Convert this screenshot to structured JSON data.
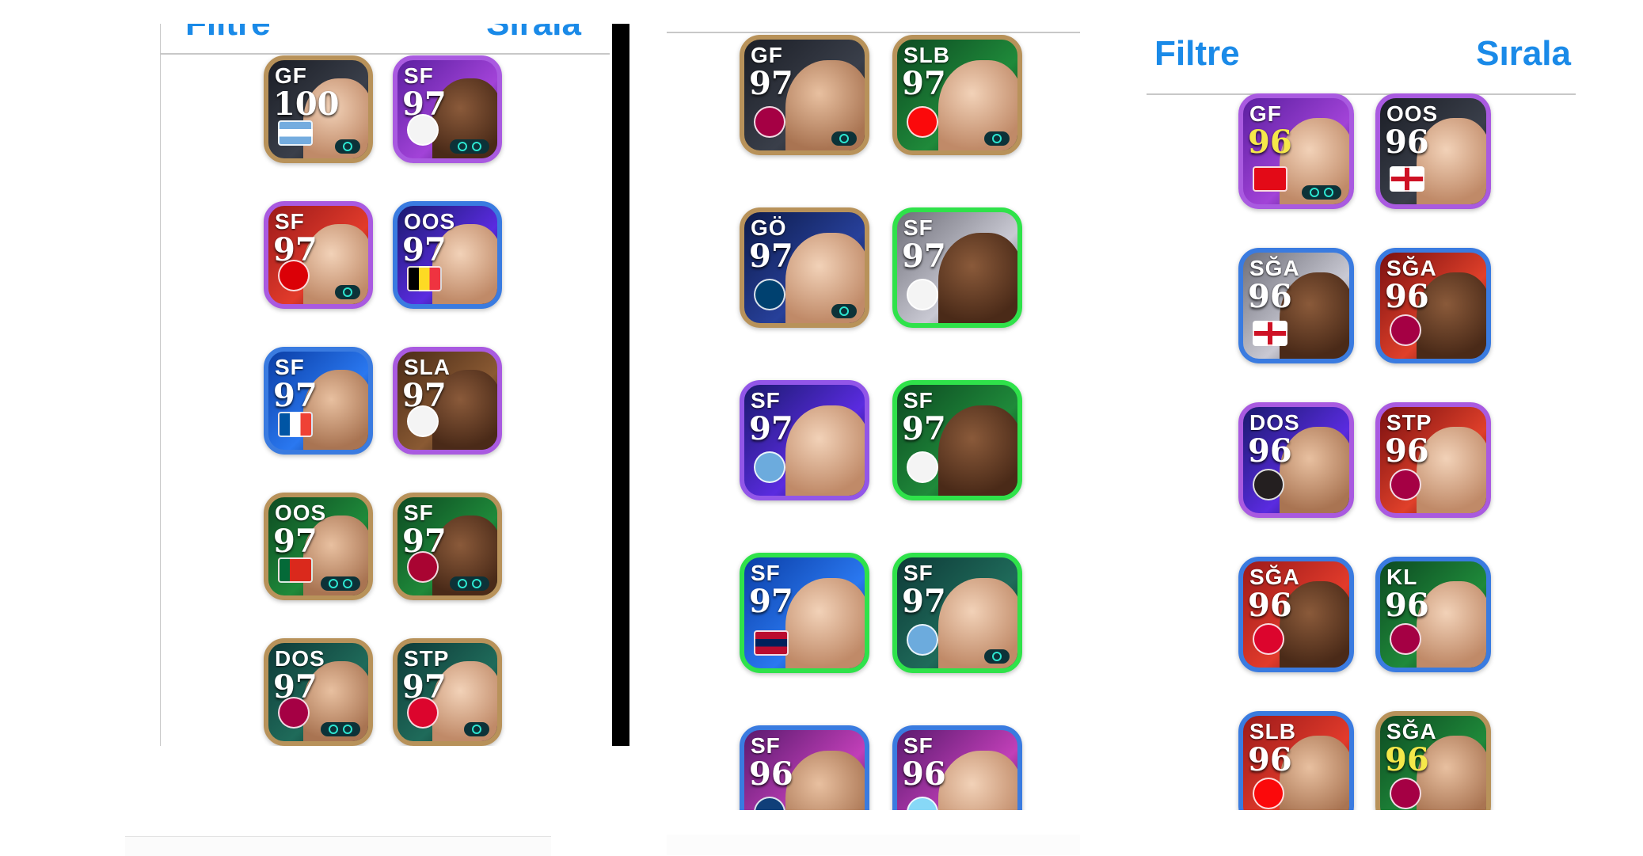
{
  "panel1": {
    "nav": {
      "filter": "Filtre",
      "sort": "Sırala"
    },
    "cards": [
      {
        "pos": "GF",
        "rating": "100",
        "frame": "gold",
        "bg": "dark",
        "skin": "c",
        "emblem": "flag-argentina",
        "badges": 1
      },
      {
        "pos": "SF",
        "rating": "97",
        "frame": "purple",
        "bg": "purple",
        "skin": "b",
        "emblem": "club-madrid",
        "badges": 2
      },
      {
        "pos": "SF",
        "rating": "97",
        "frame": "purple",
        "bg": "red",
        "skin": "c",
        "emblem": "club-arsenal",
        "badges": 1
      },
      {
        "pos": "OOS",
        "rating": "97",
        "frame": "blue",
        "bg": "indigo",
        "skin": "c",
        "emblem": "flag-belgium",
        "badges": 0
      },
      {
        "pos": "SF",
        "rating": "97",
        "frame": "blue",
        "bg": "blue",
        "skin": "a",
        "emblem": "flag-france",
        "badges": 0
      },
      {
        "pos": "SLA",
        "rating": "97",
        "frame": "purple",
        "bg": "brown",
        "skin": "b",
        "emblem": "club-madrid",
        "badges": 0
      },
      {
        "pos": "OOS",
        "rating": "97",
        "frame": "gold",
        "bg": "green",
        "skin": "a",
        "emblem": "flag-portugal",
        "badges": 2
      },
      {
        "pos": "SF",
        "rating": "97",
        "frame": "gold",
        "bg": "green",
        "skin": "b",
        "emblem": "club-galatasaray",
        "badges": 2
      },
      {
        "pos": "DOS",
        "rating": "97",
        "frame": "gold",
        "bg": "teal",
        "skin": "a",
        "emblem": "club-barcelona",
        "badges": 2
      },
      {
        "pos": "STP",
        "rating": "97",
        "frame": "gold",
        "bg": "teal",
        "skin": "c",
        "emblem": "club-munich",
        "badges": 1
      }
    ]
  },
  "panel2": {
    "cards": [
      {
        "pos": "GF",
        "rating": "97",
        "frame": "gold",
        "bg": "dark",
        "skin": "a",
        "emblem": "club-barcelona",
        "badges": 1
      },
      {
        "pos": "SLB",
        "rating": "97",
        "frame": "gold",
        "bg": "green",
        "skin": "c",
        "emblem": "club-milan",
        "badges": 1
      },
      {
        "pos": "GÖ",
        "rating": "97",
        "frame": "gold",
        "bg": "navy",
        "skin": "c",
        "emblem": "club-paris",
        "badges": 1
      },
      {
        "pos": "SF",
        "rating": "97",
        "frame": "green",
        "bg": "grey",
        "skin": "b",
        "emblem": "club-madrid",
        "badges": 0
      },
      {
        "pos": "SF",
        "rating": "97",
        "frame": "violet",
        "bg": "indigo",
        "skin": "c",
        "emblem": "club-manchester",
        "badges": 0
      },
      {
        "pos": "SF",
        "rating": "97",
        "frame": "green",
        "bg": "green",
        "skin": "b",
        "emblem": "club-madrid",
        "badges": 0
      },
      {
        "pos": "SF",
        "rating": "97",
        "frame": "green",
        "bg": "blue",
        "skin": "c",
        "emblem": "flag-norway",
        "badges": 0
      },
      {
        "pos": "SF",
        "rating": "97",
        "frame": "green",
        "bg": "teal",
        "skin": "c",
        "emblem": "club-manchester",
        "badges": 1
      },
      {
        "pos": "SF",
        "rating": "96",
        "frame": "blue",
        "bg": "magenta",
        "skin": "a",
        "emblem": "club-boca",
        "badges": 0
      },
      {
        "pos": "SF",
        "rating": "96",
        "frame": "blue",
        "bg": "magenta",
        "skin": "c",
        "emblem": "club-lazio",
        "badges": 0
      }
    ]
  },
  "panel3": {
    "nav": {
      "filter": "Filtre",
      "sort": "Sırala"
    },
    "cards": [
      {
        "pos": "GF",
        "rating": "96",
        "ratingGold": true,
        "frame": "purple",
        "bg": "purple",
        "skin": "c",
        "emblem": "flag-turkey",
        "badges": 2
      },
      {
        "pos": "OOS",
        "rating": "96",
        "frame": "purple",
        "bg": "dark",
        "skin": "c",
        "emblem": "flag-england",
        "badges": 0
      },
      {
        "pos": "SĞA",
        "rating": "96",
        "frame": "blue",
        "bg": "grey",
        "skin": "b",
        "emblem": "flag-england",
        "badges": 0
      },
      {
        "pos": "SĞA",
        "rating": "96",
        "frame": "blue",
        "bg": "orange",
        "skin": "b",
        "emblem": "club-barcelona",
        "badges": 0
      },
      {
        "pos": "DOS",
        "rating": "96",
        "frame": "purple",
        "bg": "indigo",
        "skin": "a",
        "emblem": "club-newcastle",
        "badges": 0
      },
      {
        "pos": "STP",
        "rating": "96",
        "frame": "purple",
        "bg": "orange",
        "skin": "c",
        "emblem": "club-barcelona",
        "badges": 0
      },
      {
        "pos": "SĞA",
        "rating": "96",
        "frame": "blue",
        "bg": "red",
        "skin": "b",
        "emblem": "club-munich",
        "badges": 0
      },
      {
        "pos": "KL",
        "rating": "96",
        "frame": "blue",
        "bg": "green",
        "skin": "c",
        "emblem": "club-barcelona",
        "badges": 0
      },
      {
        "pos": "SLB",
        "rating": "96",
        "frame": "blue",
        "bg": "red",
        "skin": "a",
        "emblem": "club-milan",
        "badges": 0
      },
      {
        "pos": "SĞA",
        "rating": "96",
        "ratingGold": true,
        "frame": "gold",
        "bg": "green",
        "skin": "a",
        "emblem": "club-barcelona",
        "badges": 0
      }
    ]
  },
  "colors": {
    "link": "#1a8ae8",
    "flag-argentina": [
      "#74acdf",
      "#ffffff",
      "#74acdf"
    ],
    "flag-belgium": [
      "#000000",
      "#fdda24",
      "#ef3340"
    ],
    "flag-france": [
      "#0055a4",
      "#ffffff",
      "#ef4135"
    ],
    "flag-portugal": [
      "#046a38",
      "#da291c",
      "#da291c"
    ],
    "flag-norway": [
      "#ba0c2f",
      "#00205b",
      "#ba0c2f"
    ],
    "flag-turkey": [
      "#e30a17",
      "#e30a17",
      "#e30a17"
    ],
    "flag-england": [
      "#ffffff",
      "#ce1124",
      "#ffffff"
    ]
  }
}
